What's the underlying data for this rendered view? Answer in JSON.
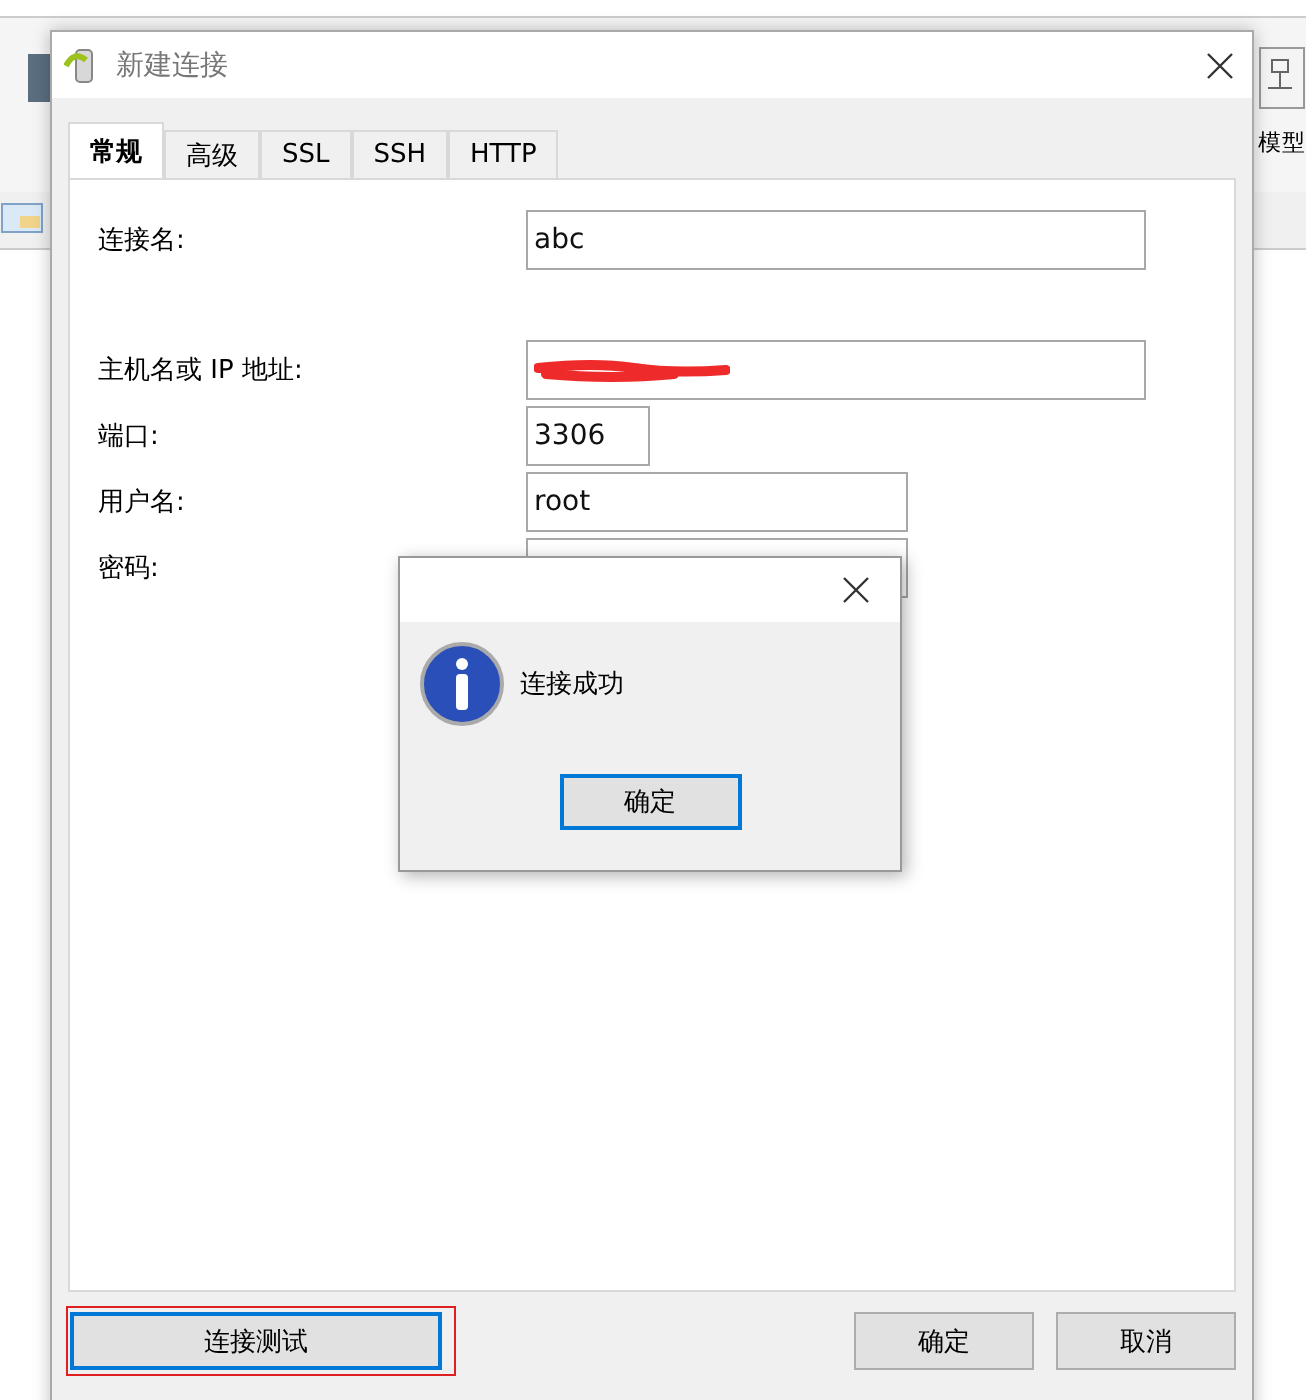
{
  "background_app": {
    "toolbar_label": "模型"
  },
  "dialog": {
    "title": "新建连接",
    "tabs": [
      {
        "label": "常规",
        "selected": true
      },
      {
        "label": "高级",
        "selected": false
      },
      {
        "label": "SSL",
        "selected": false
      },
      {
        "label": "SSH",
        "selected": false
      },
      {
        "label": "HTTP",
        "selected": false
      }
    ],
    "fields": [
      {
        "label": "连接名:",
        "value": "abc",
        "kind": "text"
      },
      {
        "label": "主机名或 IP 地址:",
        "kind": "redacted"
      },
      {
        "label": "端口:",
        "value": "3306",
        "kind": "text"
      },
      {
        "label": "用户名:",
        "value": "root",
        "kind": "text"
      },
      {
        "label": "密码:",
        "kind": "password"
      }
    ],
    "buttons": [
      {
        "label": "连接测试",
        "focused": true,
        "highlighted": true
      },
      {
        "label": "确定",
        "focused": false,
        "highlighted": false
      },
      {
        "label": "取消",
        "focused": false,
        "highlighted": false
      }
    ]
  },
  "message_box": {
    "message": "连接成功",
    "button": "确定"
  }
}
